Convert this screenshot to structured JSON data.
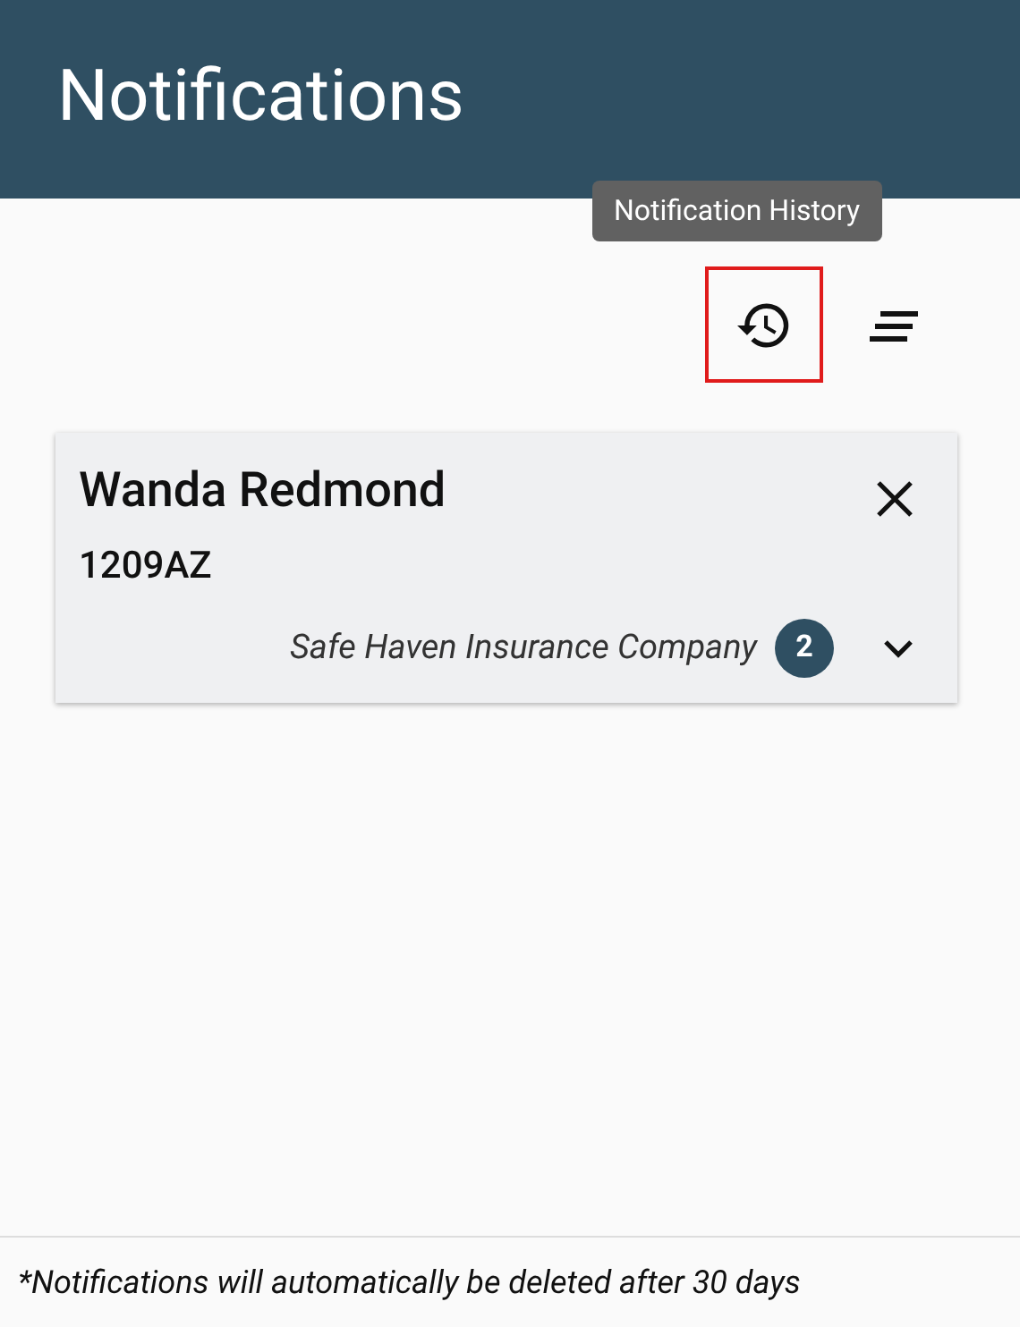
{
  "header": {
    "title": "Notifications"
  },
  "toolbar": {
    "tooltip": "Notification History",
    "history_button": {
      "highlighted": true
    }
  },
  "notifications": [
    {
      "name": "Wanda Redmond",
      "code": "1209AZ",
      "company": "Safe Haven Insurance Company",
      "count": "2",
      "expanded": false
    }
  ],
  "footer": {
    "note": "*Notifications will automatically be deleted after 30 days"
  }
}
